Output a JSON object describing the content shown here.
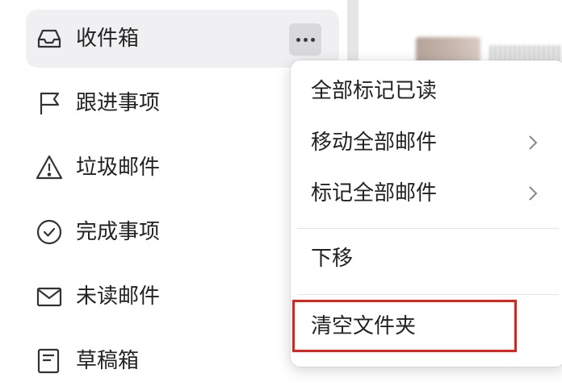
{
  "sidebar": {
    "items": [
      {
        "label": "收件箱",
        "icon": "inbox-icon",
        "active": true
      },
      {
        "label": "跟进事项",
        "icon": "flag-icon"
      },
      {
        "label": "垃圾邮件",
        "icon": "warning-icon"
      },
      {
        "label": "完成事项",
        "icon": "check-circle-icon"
      },
      {
        "label": "未读邮件",
        "icon": "envelope-icon"
      },
      {
        "label": "草稿箱",
        "icon": "draft-icon"
      }
    ]
  },
  "context_menu": {
    "items": [
      {
        "label": "全部标记已读"
      },
      {
        "label": "移动全部邮件",
        "has_submenu": true
      },
      {
        "label": "标记全部邮件",
        "has_submenu": true
      },
      {
        "label": "下移"
      },
      {
        "label": "清空文件夹",
        "highlighted": true
      }
    ]
  },
  "colors": {
    "highlight": "#e0211c",
    "active_bg": "#f0f0f2"
  }
}
